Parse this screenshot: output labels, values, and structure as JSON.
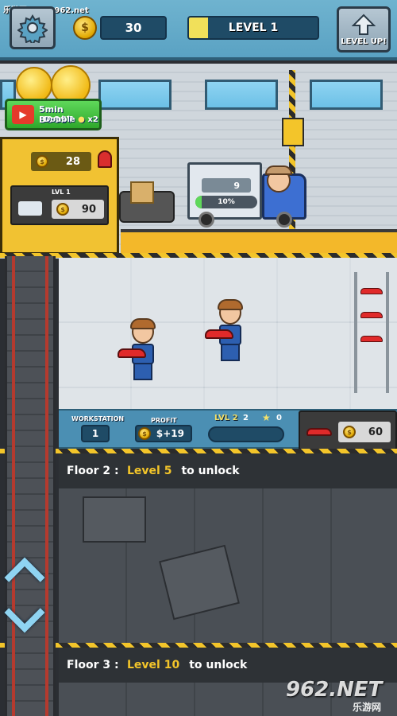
{
  "site_label": "乐游网 www.962.net",
  "hud": {
    "coins": "30",
    "coin_symbol": "$",
    "level_label": "LEVEL 1",
    "level_progress": 0.15,
    "level_up_label": "LEVEL UP!"
  },
  "boost": {
    "line1": "5min BOOST",
    "line2": "Double",
    "line2_suffix": "x2"
  },
  "warehouse": {
    "count": "28",
    "level": "LVL 1",
    "value": "90"
  },
  "truck": {
    "count": "9",
    "progress_label": "10%",
    "progress": 0.1
  },
  "floor1": {
    "workstation_label": "WORKSTATION",
    "workstation_value": "1",
    "profit_label": "PROFIT",
    "profit_value": "$+19",
    "lvl_label": "LVL 2",
    "workers": "2",
    "stars": "0",
    "sell_value": "60"
  },
  "floor2": {
    "name": "Floor 2 :",
    "level": "Level 5",
    "suffix": "to unlock"
  },
  "floor3": {
    "name": "Floor 3 :",
    "level": "Level 10",
    "suffix": "to unlock"
  },
  "watermark": {
    "main": "962.NET",
    "sub": "乐游网"
  },
  "colors": {
    "hud_bg": "#5aa2c3",
    "accent_yellow": "#f3c52a",
    "boost_green": "#2fa82c",
    "car_red": "#e02a2a"
  },
  "icons": [
    "gear-icon",
    "arrow-up-icon",
    "coin-icon",
    "play-icon",
    "truck-icon",
    "car-icon",
    "star-icon",
    "chevron-up-icon",
    "chevron-down-icon",
    "alarm-icon"
  ]
}
